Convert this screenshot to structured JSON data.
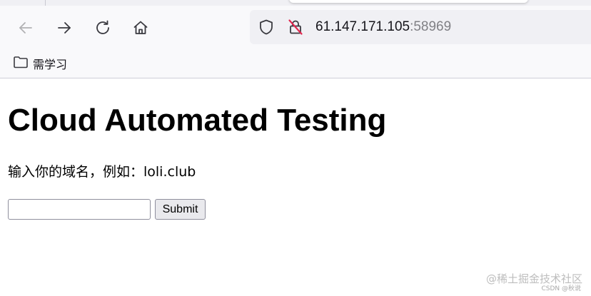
{
  "browser": {
    "url": {
      "host": "61.147.171.105",
      "port": ":58969"
    },
    "bookmarks": [
      {
        "label": "需学习",
        "icon": "folder-icon"
      }
    ],
    "icons": {
      "back": "back-arrow-icon",
      "forward": "forward-arrow-icon",
      "reload": "reload-icon",
      "home": "home-icon",
      "tracking": "shield-icon",
      "insecure": "insecure-lock-icon"
    }
  },
  "page": {
    "title": "Cloud Automated Testing",
    "prompt": "输入你的域名，例如：loli.club",
    "form": {
      "input_value": "",
      "submit_label": "Submit"
    }
  },
  "watermark": {
    "text": "@稀土掘金技术社区",
    "subtext": "CSDN @秋说"
  },
  "colors": {
    "toolbar_bg": "#f9f9fb",
    "urlbar_bg": "#f0f0f4",
    "insecure_red": "#e22850",
    "button_bg": "#e9e9ed"
  }
}
